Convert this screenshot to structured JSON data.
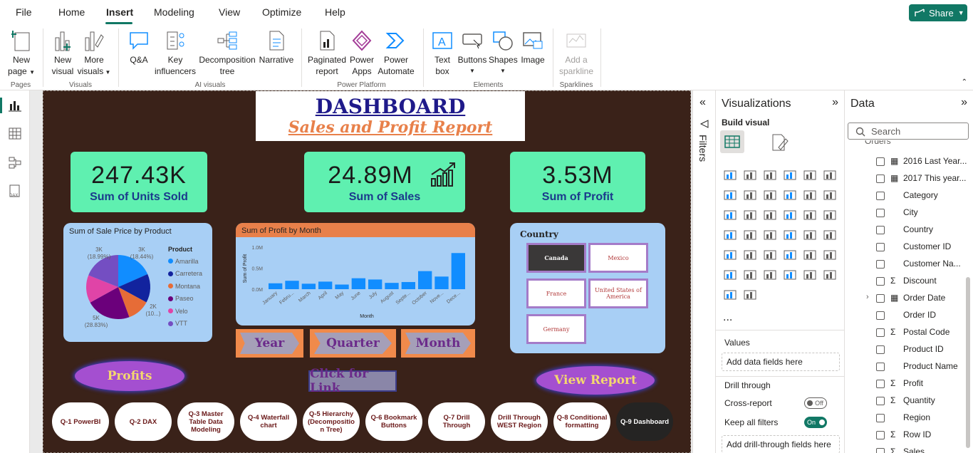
{
  "menu": {
    "file": "File",
    "home": "Home",
    "insert": "Insert",
    "modeling": "Modeling",
    "view": "View",
    "optimize": "Optimize",
    "help": "Help",
    "share": "Share"
  },
  "ribbon": {
    "new_page_1": "New",
    "new_page_2": "page",
    "new_visual_1": "New",
    "new_visual_2": "visual",
    "more_visuals_1": "More",
    "more_visuals_2": "visuals",
    "qa": "Q&A",
    "key_infl_1": "Key",
    "key_infl_2": "influencers",
    "decomp_1": "Decomposition",
    "decomp_2": "tree",
    "narrative": "Narrative",
    "paginated_1": "Paginated",
    "paginated_2": "report",
    "power_apps_1": "Power",
    "power_apps_2": "Apps",
    "power_auto_1": "Power",
    "power_auto_2": "Automate",
    "textbox_1": "Text",
    "textbox_2": "box",
    "buttons": "Buttons",
    "shapes": "Shapes",
    "image": "Image",
    "sparkline_1": "Add a",
    "sparkline_2": "sparkline",
    "groups": {
      "pages": "Pages",
      "visuals": "Visuals",
      "ai": "AI visuals",
      "power_platform": "Power Platform",
      "elements": "Elements",
      "sparklines": "Sparklines"
    }
  },
  "report": {
    "title": "DASHBOARD",
    "subtitle": "Sales and Profit Report",
    "kpis": [
      {
        "value": "247.43K",
        "label": "Sum of Units Sold"
      },
      {
        "value": "24.89M",
        "label": "Sum of  Sales"
      },
      {
        "value": "3.53M",
        "label": "Sum of Profit"
      }
    ],
    "segments": {
      "year": "Year",
      "quarter": "Quarter",
      "month": "Month"
    },
    "buttons": {
      "profits": "Profits",
      "link": "Click for Link",
      "view_report": "View Report"
    },
    "nav": [
      "Q-1 PowerBI",
      "Q-2 DAX",
      "Q-3 Master Table Data Modeling",
      "Q-4 Waterfall chart",
      "Q-5 Hierarchy (Decompositio n Tree)",
      "Q-6 Bookmark Buttons",
      "Q-7 Drill Through",
      "Drill Through WEST Region",
      "Q-8 Conditional formatting",
      "Q-9 Dashboard"
    ],
    "country": {
      "title": "Country",
      "items": [
        "Canada",
        "Mexico",
        "France",
        "United States of America",
        "Germany"
      ],
      "selected": "Canada"
    }
  },
  "chart_data": [
    {
      "type": "pie",
      "title": "Sum of Sale Price by Product",
      "legend_title": "Product",
      "legend_position": "right",
      "categories": [
        "Amarilla",
        "Carretera",
        "Montana",
        "Paseo",
        "Velo",
        "VTT"
      ],
      "values": [
        18.44,
        14.5,
        11.5,
        22.59,
        14.08,
        18.99
      ],
      "colors": [
        "#118dff",
        "#12239e",
        "#e66c37",
        "#6b007b",
        "#e044a7",
        "#744ec2"
      ],
      "data_labels": [
        "3K",
        "(18.44%)",
        "3K",
        "(18.99%)",
        "2K",
        "(10...)",
        "5K",
        "(28.83%)"
      ]
    },
    {
      "type": "bar",
      "title": "Sum of Profit by Month",
      "xlabel": "Month",
      "ylabel": "Sum of Profit",
      "ylim": [
        0,
        1000000
      ],
      "yticks": [
        "0.0M",
        "0.5M",
        "1.0M"
      ],
      "categories": [
        "January",
        "Febru...",
        "March",
        "April",
        "May",
        "June",
        "July",
        "August",
        "Septe...",
        "October",
        "Nove...",
        "Dece..."
      ],
      "values": [
        140000,
        200000,
        130000,
        180000,
        110000,
        260000,
        230000,
        150000,
        170000,
        430000,
        300000,
        860000
      ],
      "color": "#118dff"
    }
  ],
  "filters": {
    "label": "Filters"
  },
  "viz": {
    "title": "Visualizations",
    "build": "Build visual",
    "values_label": "Values",
    "values_well": "Add data fields here",
    "drill": "Drill through",
    "cross_report": "Cross-report",
    "cross_state": "Off",
    "keep_filters": "Keep all filters",
    "keep_state": "On",
    "drill_well": "Add drill-through fields here",
    "more": "..."
  },
  "data": {
    "title": "Data",
    "search_placeholder": "Search",
    "table": "Orders",
    "fields": [
      {
        "name": "2016 Last Year...",
        "kind": "calc"
      },
      {
        "name": "2017 This year...",
        "kind": "calc"
      },
      {
        "name": "Category",
        "kind": ""
      },
      {
        "name": "City",
        "kind": ""
      },
      {
        "name": "Country",
        "kind": ""
      },
      {
        "name": "Customer ID",
        "kind": ""
      },
      {
        "name": "Customer Na...",
        "kind": ""
      },
      {
        "name": "Discount",
        "kind": "sum"
      },
      {
        "name": "Order Date",
        "kind": "date"
      },
      {
        "name": "Order ID",
        "kind": ""
      },
      {
        "name": "Postal Code",
        "kind": "sum"
      },
      {
        "name": "Product ID",
        "kind": ""
      },
      {
        "name": "Product Name",
        "kind": ""
      },
      {
        "name": "Profit",
        "kind": "sum"
      },
      {
        "name": "Quantity",
        "kind": "sum"
      },
      {
        "name": "Region",
        "kind": ""
      },
      {
        "name": "Row ID",
        "kind": "sum"
      },
      {
        "name": "Sales",
        "kind": "sum"
      }
    ]
  }
}
